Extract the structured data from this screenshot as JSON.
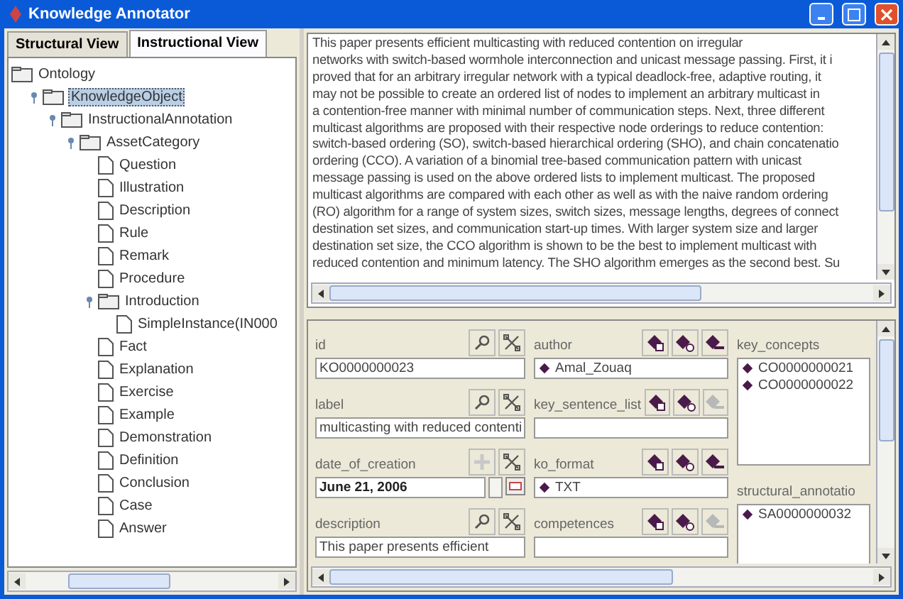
{
  "window": {
    "title": "Knowledge Annotator"
  },
  "tabs": [
    {
      "label": "Structural View",
      "selected": false
    },
    {
      "label": "Instructional View",
      "selected": true
    }
  ],
  "tree": [
    {
      "label": "Ontology",
      "kind": "folder",
      "selected": false,
      "children": [
        {
          "label": "KnowledgeObject",
          "kind": "folder",
          "expanded": true,
          "selected": true,
          "children": [
            {
              "label": "InstructionalAnnotation",
              "kind": "folder",
              "expanded": true,
              "selected": false,
              "children": [
                {
                  "label": "AssetCategory",
                  "kind": "folder",
                  "expanded": true,
                  "selected": false,
                  "children": [
                    {
                      "label": "Question",
                      "kind": "leaf",
                      "selected": false
                    },
                    {
                      "label": "Illustration",
                      "kind": "leaf",
                      "selected": false
                    },
                    {
                      "label": "Description",
                      "kind": "leaf",
                      "selected": false
                    },
                    {
                      "label": "Rule",
                      "kind": "leaf",
                      "selected": false
                    },
                    {
                      "label": "Remark",
                      "kind": "leaf",
                      "selected": false
                    },
                    {
                      "label": "Procedure",
                      "kind": "leaf",
                      "selected": false
                    },
                    {
                      "label": "Introduction",
                      "kind": "folder",
                      "expanded": true,
                      "selected": false,
                      "children": [
                        {
                          "label": "SimpleInstance(IN000",
                          "kind": "leaf",
                          "selected": false
                        }
                      ]
                    },
                    {
                      "label": "Fact",
                      "kind": "leaf",
                      "selected": false
                    },
                    {
                      "label": "Explanation",
                      "kind": "leaf",
                      "selected": false
                    },
                    {
                      "label": "Exercise",
                      "kind": "leaf",
                      "selected": false
                    },
                    {
                      "label": "Example",
                      "kind": "leaf",
                      "selected": false
                    },
                    {
                      "label": "Demonstration",
                      "kind": "leaf",
                      "selected": false
                    },
                    {
                      "label": "Definition",
                      "kind": "leaf",
                      "selected": false
                    },
                    {
                      "label": "Conclusion",
                      "kind": "leaf",
                      "selected": false
                    },
                    {
                      "label": "Case",
                      "kind": "leaf",
                      "selected": false
                    },
                    {
                      "label": "Answer",
                      "kind": "leaf",
                      "selected": false
                    }
                  ]
                }
              ]
            }
          ]
        }
      ]
    }
  ],
  "abstract_lines": [
    "This paper presents efficient multicasting with reduced contention on irregular",
    "networks with switch-based wormhole interconnection and unicast message passing. First, it i",
    "proved that for an arbitrary irregular network with a typical deadlock-free, adaptive routing, it",
    "may not be possible to create an ordered list of nodes to implement an arbitrary multicast in",
    "a contention-free manner with minimal number of communication steps. Next, three different",
    "multicast algorithms are proposed with their respective node orderings to reduce contention:",
    "switch-based ordering (SO), switch-based hierarchical ordering (SHO), and chain concatenatio",
    "ordering (CCO). A variation of a binomial tree-based communication pattern with unicast",
    "message passing is used on the above ordered lists to implement multicast. The proposed",
    "multicast algorithms are compared with each other as well as with the naive random ordering",
    "(RO) algorithm for a range of system sizes, switch sizes, message lengths, degrees of connect",
    "destination set sizes, and communication start-up times. With larger system size and larger",
    "destination set size, the CCO algorithm is shown to be the best to implement multicast with",
    "reduced contention and minimum latency. The SHO algorithm emerges as the second best. Su"
  ],
  "form": {
    "columns": [
      [
        {
          "label": "id",
          "kind": "text",
          "value": "KO0000000023",
          "buttons": [
            {
              "kind": "search",
              "disabled": false
            },
            {
              "kind": "delete",
              "disabled": false
            }
          ]
        },
        {
          "label": "label",
          "kind": "text",
          "value": "multicasting with reduced contenti",
          "buttons": [
            {
              "kind": "search",
              "disabled": false
            },
            {
              "kind": "delete",
              "disabled": false
            }
          ]
        },
        {
          "label": "date_of_creation",
          "kind": "date",
          "value": "June 21, 2006",
          "buttons": [
            {
              "kind": "add",
              "disabled": true
            },
            {
              "kind": "delete",
              "disabled": false
            }
          ]
        },
        {
          "label": "description",
          "kind": "textarea",
          "value": "This paper presents efficient",
          "buttons": [
            {
              "kind": "search",
              "disabled": false
            },
            {
              "kind": "delete",
              "disabled": false
            }
          ]
        }
      ],
      [
        {
          "label": "author",
          "kind": "instance",
          "value": "Amal_Zouaq",
          "buttons": [
            {
              "kind": "lock",
              "disabled": false
            },
            {
              "kind": "create",
              "disabled": false
            },
            {
              "kind": "remove",
              "disabled": false
            }
          ]
        },
        {
          "label": "key_sentence_list",
          "kind": "instance",
          "buttons": [
            {
              "kind": "lock",
              "disabled": false
            },
            {
              "kind": "create",
              "disabled": false
            },
            {
              "kind": "remove",
              "disabled": true
            }
          ]
        },
        {
          "label": "ko_format",
          "kind": "instance",
          "value": "TXT",
          "buttons": [
            {
              "kind": "lock",
              "disabled": false
            },
            {
              "kind": "create",
              "disabled": false
            },
            {
              "kind": "remove",
              "disabled": false
            }
          ]
        },
        {
          "label": "competences",
          "kind": "instance",
          "buttons": [
            {
              "kind": "lock",
              "disabled": false
            },
            {
              "kind": "create",
              "disabled": false
            },
            {
              "kind": "remove",
              "disabled": true
            }
          ]
        }
      ],
      [
        {
          "label": "key_concepts",
          "kind": "list",
          "values": [
            "CO0000000021",
            "CO0000000022"
          ]
        },
        {
          "label": "structural_annotatio",
          "kind": "list",
          "values": [
            "SA0000000032"
          ]
        }
      ]
    ]
  }
}
